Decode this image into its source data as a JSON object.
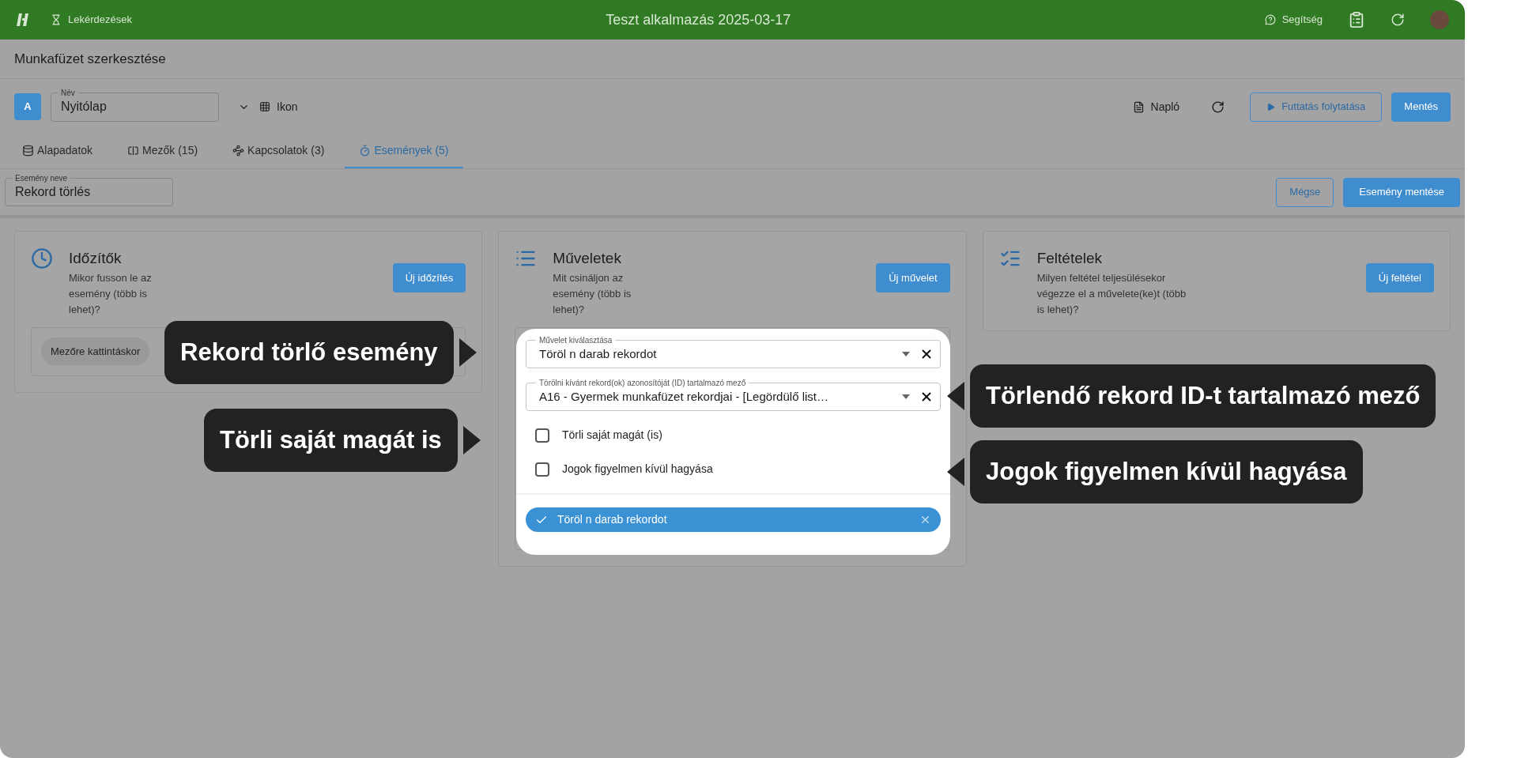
{
  "top_bar": {
    "nav_link": "Lekérdezések",
    "title": "Teszt alkalmazás 2025-03-17",
    "help": "Segítség"
  },
  "page_title": "Munkafüzet szerkesztése",
  "workbook": {
    "badge": "A",
    "name_label": "Név",
    "name_value": "Nyitólap",
    "icon_label": "Ikon"
  },
  "toolbar": {
    "log": "Napló",
    "run": "Futtatás folytatása",
    "save": "Mentés"
  },
  "tabs": [
    {
      "kind": "database",
      "label": "Alapadatok",
      "selected": false
    },
    {
      "kind": "fields",
      "label": "Mezők (15)",
      "selected": false
    },
    {
      "kind": "links",
      "label": "Kapcsolatok (3)",
      "selected": false
    },
    {
      "kind": "events",
      "label": "Események (5)",
      "selected": true
    }
  ],
  "event": {
    "name_label": "Esemény neve",
    "name_value": "Rekord törlés",
    "cancel": "Mégse",
    "save": "Esemény mentése"
  },
  "cards": [
    {
      "kind": "timers",
      "title": "Időzítők",
      "description": "Mikor fusson le az esemény (több is lehet)?",
      "button": "Új időzítés",
      "chip": "Mezőre kattintáskor"
    },
    {
      "kind": "actions",
      "title": "Műveletek",
      "description": "Mit csináljon az esemény (több is lehet)?",
      "button": "Új művelet"
    },
    {
      "kind": "conditions",
      "title": "Feltételek",
      "description": "Milyen feltétel teljesülésekor végezze el a művelete(ke)t (több is lehet)?",
      "button": "Új feltétel"
    }
  ],
  "popup": {
    "fields": [
      {
        "label": "Művelet kiválasztása",
        "value": "Töröl n darab rekordot"
      },
      {
        "label": "Törölni kívánt rekord(ok) azonosítóját (ID) tartalmazó mező",
        "value": "A16 - Gyermek munkafüzet rekordjai - [Legördülő list…"
      }
    ],
    "checkboxes": [
      {
        "label": "Törli saját magát (is)",
        "checked": false
      },
      {
        "label": "Jogok figyelmen kívül hagyása",
        "checked": false
      }
    ],
    "selected_action": "Töröl n darab rekordot"
  },
  "callouts": [
    {
      "text": "Rekord törlő esemény",
      "kind": "left"
    },
    {
      "text": "Törlendő rekord ID-t tartalmazó mező",
      "kind": "right"
    },
    {
      "text": "Törli saját magát is",
      "kind": "left"
    },
    {
      "text": "Jogok figyelmen kívül hagyása",
      "kind": "right"
    }
  ]
}
